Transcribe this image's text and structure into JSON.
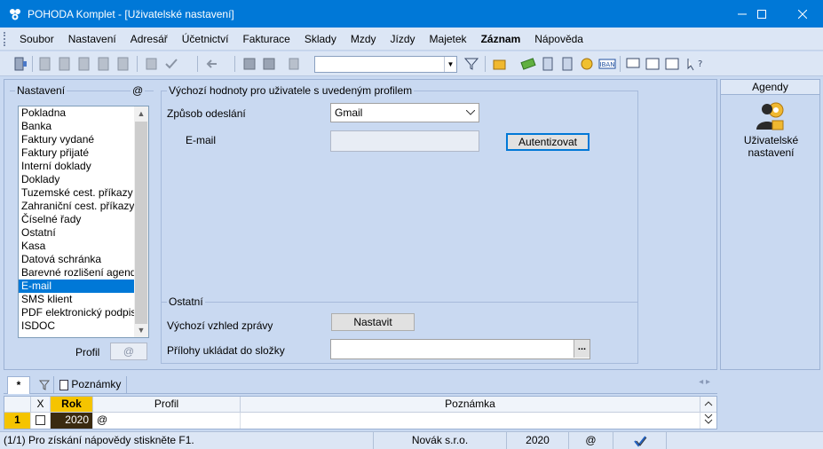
{
  "window": {
    "title": "POHODA Komplet - [Uživatelské nastavení]",
    "controls": [
      "minimize-icon",
      "maximize-icon",
      "close-icon"
    ]
  },
  "menu": {
    "items": [
      "Soubor",
      "Nastavení",
      "Adresář",
      "Účetnictví",
      "Fakturace",
      "Sklady",
      "Mzdy",
      "Jízdy",
      "Majetek",
      "Záznam",
      "Nápověda"
    ]
  },
  "toolbar": {
    "combo_value": ""
  },
  "nastaveni": {
    "label": "Nastavení",
    "at_symbol": "@",
    "items": [
      "Pokladna",
      "Banka",
      "Faktury vydané",
      "Faktury přijaté",
      "Interní doklady",
      "Doklady",
      "Tuzemské cest. příkazy",
      "Zahraniční cest. příkazy",
      "Číselné řady",
      "Ostatní",
      "Kasa",
      "Datová schránka",
      "Barevné rozlišení agend",
      "E-mail",
      "SMS klient",
      "PDF elektronický podpis",
      "ISDOC"
    ],
    "selected": "E-mail",
    "profil_label": "Profil",
    "profil_value": "@"
  },
  "defaults": {
    "group_label": "Výchozí hodnoty pro uživatele s uvedeným profilem",
    "sending_label": "Způsob odeslání",
    "sending_value": "Gmail",
    "email_label": "E-mail",
    "email_value": "",
    "auth_button": "Autentizovat"
  },
  "other": {
    "group_label": "Ostatní",
    "view_label": "Výchozí vzhled zprávy",
    "view_button": "Nastavit",
    "attachments_label": "Přílohy ukládat do složky",
    "attachments_value": "",
    "browse_button": "..."
  },
  "agendy": {
    "header": "Agendy",
    "item_line1": "Uživatelské",
    "item_line2": "nastavení"
  },
  "tabs": {
    "star": "*",
    "notes": "Poznámky"
  },
  "grid": {
    "columns": [
      "X",
      "Rok",
      "Profil",
      "Poznámka"
    ],
    "rows": [
      {
        "num": "1",
        "x": "",
        "rok": "2020",
        "profil": "@",
        "poznamka": ""
      }
    ]
  },
  "status": {
    "help": "(1/1) Pro získání nápovědy stiskněte F1.",
    "company": "Novák s.r.o.",
    "year": "2020",
    "at": "@"
  },
  "colors": {
    "titlebar": "#0078d7",
    "selection": "#0078d7",
    "panel": "#c9d9f1"
  }
}
